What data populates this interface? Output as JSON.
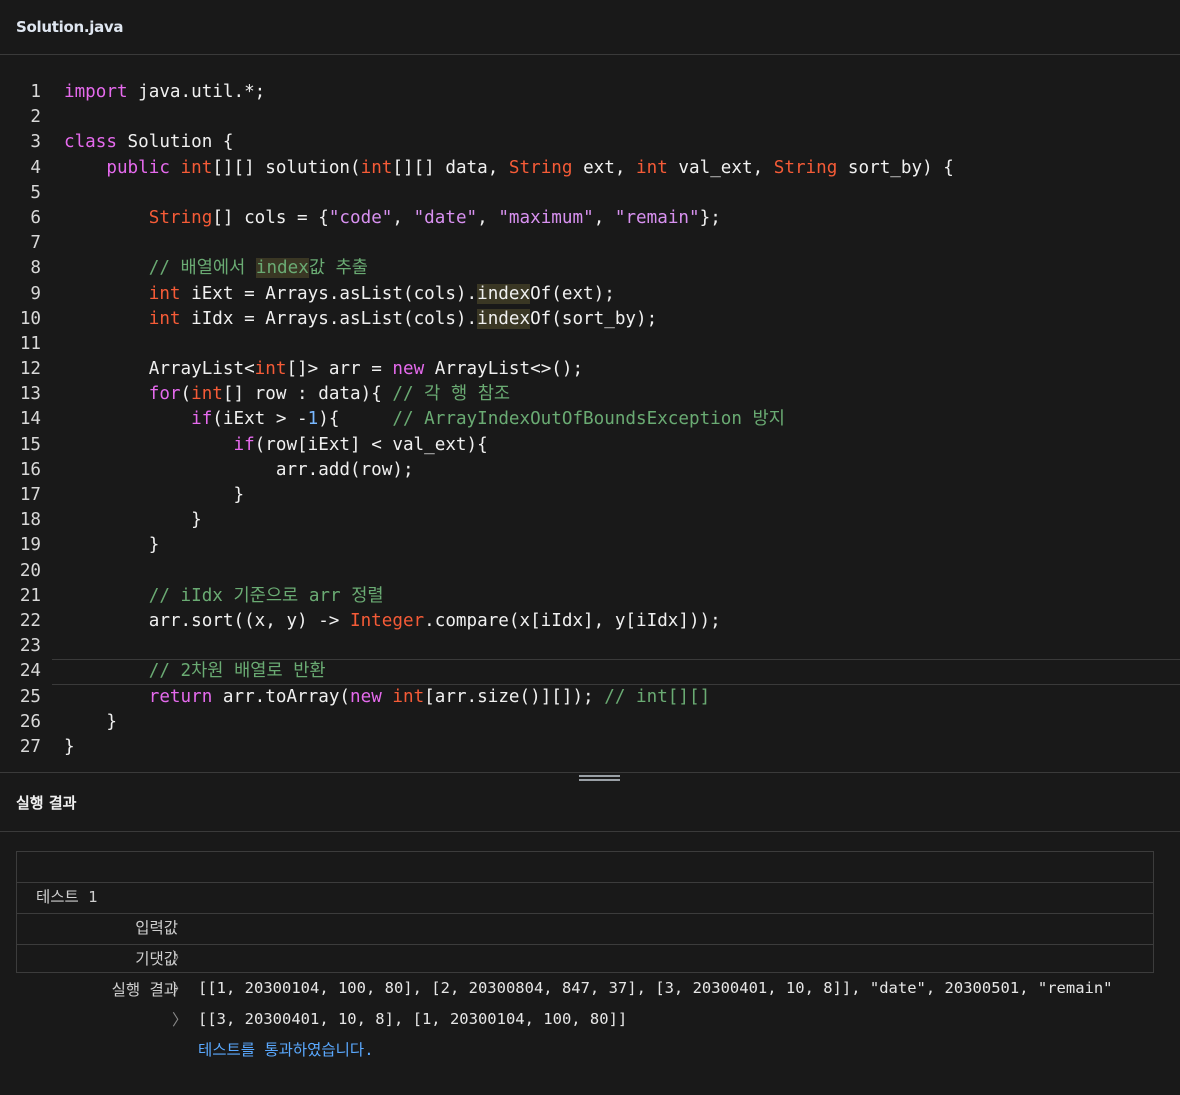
{
  "tab": {
    "title": "Solution.java"
  },
  "code_lines": [
    "import java.util.*;",
    "",
    "class Solution {",
    "    public int[][] solution(int[][] data, String ext, int val_ext, String sort_by) {",
    "",
    "        String[] cols = {\"code\", \"date\", \"maximum\", \"remain\"};",
    "",
    "        // 배열에서 index값 추출",
    "        int iExt = Arrays.asList(cols).indexOf(ext);",
    "        int iIdx = Arrays.asList(cols).indexOf(sort_by);",
    "",
    "        ArrayList<int[]> arr = new ArrayList<>();",
    "        for(int[] row : data){ // 각 행 참조",
    "            if(iExt > -1){     // ArrayIndexOutOfBoundsException 방지",
    "                if(row[iExt] < val_ext){",
    "                    arr.add(row);",
    "                }",
    "            }",
    "        }",
    "",
    "        // iIdx 기준으로 arr 정렬",
    "        arr.sort((x, y) -> Integer.compare(x[iIdx], y[iIdx]));",
    "",
    "        // 2차원 배열로 반환",
    "        return arr.toArray(new int[arr.size()][]); // int[][]",
    "    }",
    "}"
  ],
  "active_line": 24,
  "result": {
    "title": "실행 결과",
    "test_name": "테스트 1",
    "arrow": "〉",
    "rows": [
      {
        "label": "입력값",
        "value": "[[1, 20300104, 100, 80], [2, 20300804, 847, 37], [3, 20300401, 10, 8]], \"date\", 20300501, \"remain\""
      },
      {
        "label": "기댓값",
        "value": "[[3, 20300401, 10, 8], [1, 20300104, 100, 80]]"
      },
      {
        "label": "실행 결과",
        "value": "테스트를 통과하였습니다."
      }
    ]
  }
}
